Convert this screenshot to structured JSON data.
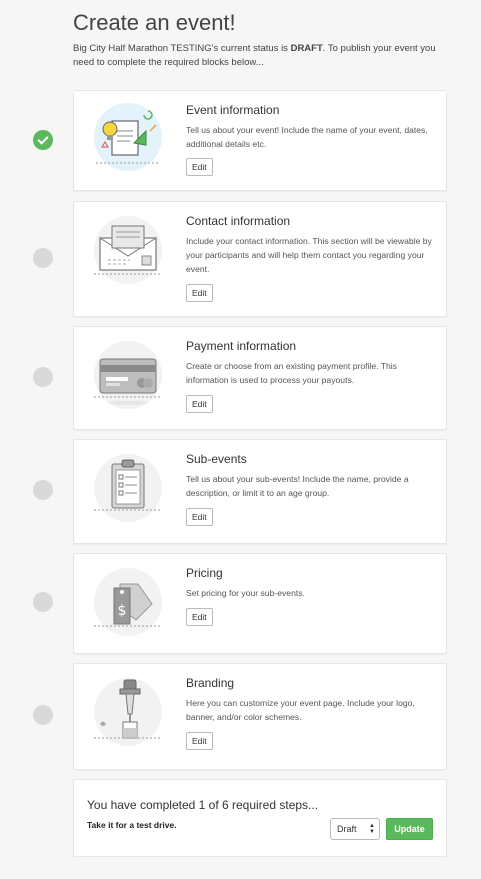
{
  "page": {
    "title": "Create an event!",
    "intro_prefix": "Big City Half Marathon TESTING's current status is ",
    "intro_status": "DRAFT",
    "intro_suffix": ". To publish your event you need to complete the required blocks below..."
  },
  "steps": [
    {
      "title": "Event information",
      "description": "Tell us about your event! Include the name of your event, dates, additional details etc.",
      "edit_label": "Edit",
      "completed": true,
      "icon": "lightbulb-document-icon"
    },
    {
      "title": "Contact information",
      "description": "Include your contact information. This section will be viewable by your participants and will help them contact you regarding your event.",
      "edit_label": "Edit",
      "completed": false,
      "icon": "envelope-icon"
    },
    {
      "title": "Payment information",
      "description": "Create or choose from an existing payment profile. This information is used to process your payouts.",
      "edit_label": "Edit",
      "completed": false,
      "icon": "credit-card-icon"
    },
    {
      "title": "Sub-events",
      "description": "Tell us about your sub-events! Include the name, provide a description, or limit it to an age group.",
      "edit_label": "Edit",
      "completed": false,
      "icon": "clipboard-checklist-icon"
    },
    {
      "title": "Pricing",
      "description": "Set pricing for your sub-events.",
      "edit_label": "Edit",
      "completed": false,
      "icon": "price-tag-icon"
    },
    {
      "title": "Branding",
      "description": "Here you can customize your event page. Include your logo, banner, and/or color schemes.",
      "edit_label": "Edit",
      "completed": false,
      "icon": "eyedropper-icon"
    }
  ],
  "summary": {
    "progress_text": "You have completed 1 of 6 required steps...",
    "subtext": "Take it for a test drive.",
    "status_value": "Draft",
    "update_label": "Update"
  },
  "colors": {
    "accent_green": "#5cb85c",
    "pending_grey": "#d9d9d9"
  }
}
